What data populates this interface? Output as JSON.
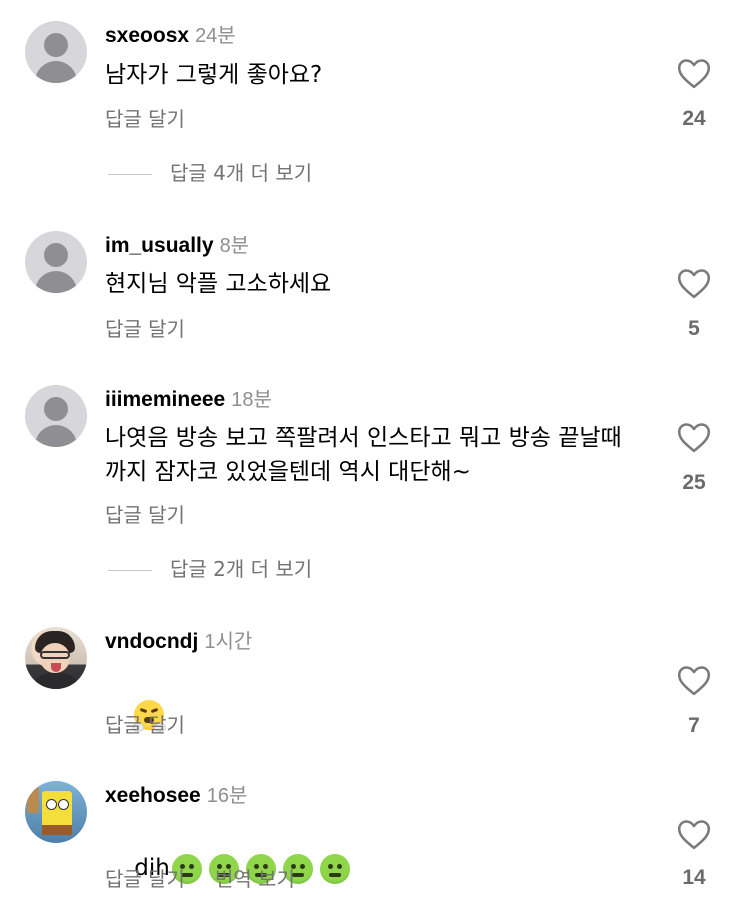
{
  "labels": {
    "reply": "답글 달기",
    "translate": "번역 보기"
  },
  "colors": {
    "text": "#000000",
    "secondary": "#737373",
    "time": "#8e8e93",
    "avatar_default": "#d7d7db"
  },
  "comments": [
    {
      "username": "sxeoosx",
      "time": "24분",
      "text": "남자가 그렇게 좋아요?",
      "likes": "24",
      "avatar": "default-avatar",
      "view_replies": "답글 4개 더 보기"
    },
    {
      "username": "im_usually",
      "time": "8분",
      "text": "현지님 악플 고소하세요",
      "likes": "5",
      "avatar": "default-avatar"
    },
    {
      "username": "iiimemineee",
      "time": "18분",
      "text": "나엿음 방송 보고 쪽팔려서 인스타고 뭐고 방송 끝날때까지 잠자코 있었을텐데 역시 대단해~",
      "likes": "25",
      "avatar": "default-avatar",
      "view_replies": "답글 2개 더 보기"
    },
    {
      "username": "vndocndj",
      "time": "1시간",
      "text": "",
      "emoji": "face-with-steam-from-nose",
      "likes": "7",
      "avatar": "person-photo-avatar"
    },
    {
      "username": "xeehosee",
      "time": "16분",
      "text": "dih",
      "emoji": "nauseated-face x5",
      "likes": "14",
      "avatar": "spongebob-photo-avatar",
      "has_translate": true
    }
  ]
}
